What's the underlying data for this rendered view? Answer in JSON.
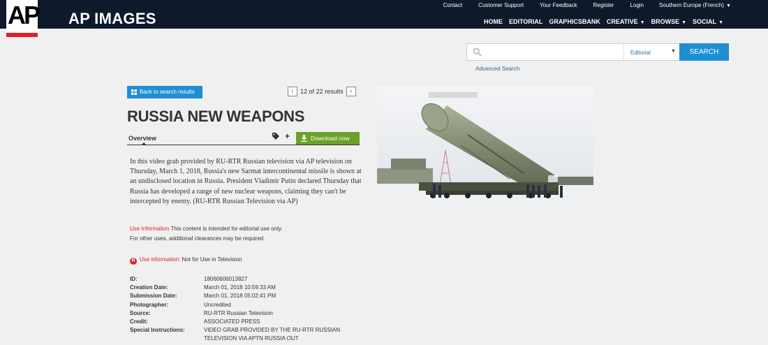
{
  "header": {
    "logo": "AP",
    "brand": "AP IMAGES",
    "top_links": [
      "Contact",
      "Customer Support",
      "Your Feedback",
      "Register",
      "Login"
    ],
    "region": "Southern Europe (French)",
    "nav": [
      "HOME",
      "EDITORIAL",
      "GRAPHICSBANK",
      "CREATIVE",
      "BROWSE",
      "SOCIAL"
    ]
  },
  "search": {
    "placeholder": "",
    "scope": "Editorial",
    "button": "SEARCH",
    "advanced": "Advanced Search"
  },
  "result": {
    "back_label": "Back to search results",
    "current": "12",
    "of_text": "of",
    "total_text": "22 results",
    "title": "RUSSIA NEW WEAPONS",
    "tab": "Overview",
    "download": "Download now",
    "description": "In this video grab provided by RU-RTR Russian television via AP television on Thursday, March 1, 2018, Russia's new Sarmat intercontinental missile is shown at an undisclosed location in Russia. President Vladimir Putin declared Thursday that Russia has developed a range of new nuclear weapons, claiming they can't be intercepted by enemy. (RU-RTR Russian Television via AP)",
    "use_label": "Use Information",
    "use_text": "This content is intended for editorial use only.",
    "use_text2": "For other uses, additional clearances may be required.",
    "restrict_icon": "R",
    "restrict_label": "Use information:",
    "restrict_text": "Not for Use in Television"
  },
  "metadata": [
    {
      "key": "ID:",
      "value": "18060606013827"
    },
    {
      "key": "Creation Date:",
      "value": "March 01, 2018 10:59:33 AM"
    },
    {
      "key": "Submission Date:",
      "value": "March 01, 2018 05:02:41 PM"
    },
    {
      "key": "Photographer:",
      "value": "Uncredited"
    },
    {
      "key": "Source:",
      "value": "RU-RTR Russian Television"
    },
    {
      "key": "Credit:",
      "value": "ASSOCIATED PRESS"
    },
    {
      "key": "Special Instructions:",
      "value": "VIDEO GRAB PROVIDED BY THE RU-RTR RUSSIAN"
    },
    {
      "key": "",
      "value": "TELEVISION VIA APTN RUSSIA OUT"
    }
  ],
  "colors": {
    "header_bg": "#0e1a2b",
    "accent_blue": "#1d8fd2",
    "download_green": "#6ba02b",
    "ap_red": "#e31f26"
  }
}
